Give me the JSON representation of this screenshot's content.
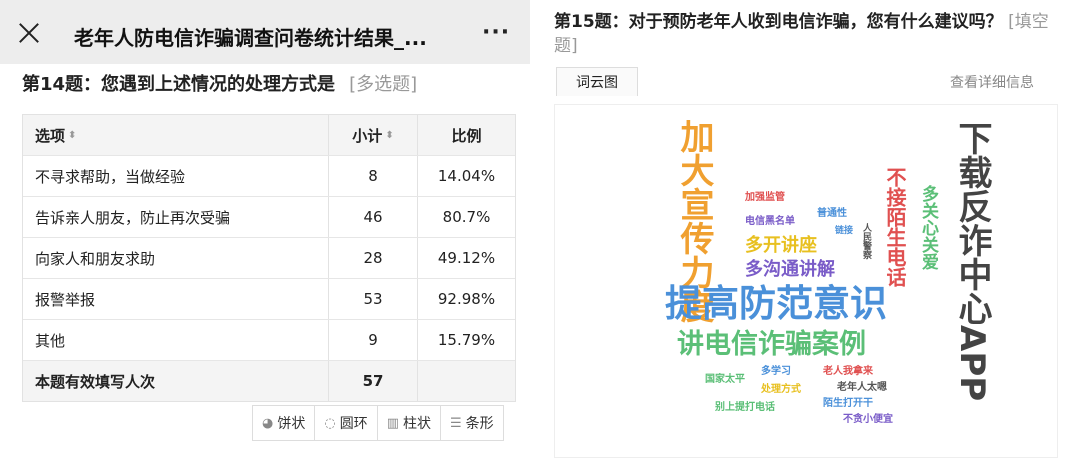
{
  "left": {
    "topbar": {
      "title": "老年人防电信诈骗调查问卷统计结果_...",
      "more": "···"
    },
    "question": {
      "title": "第14题：您遇到上述情况的处理方式是",
      "type": "[多选题]"
    },
    "table": {
      "headers": [
        "选项",
        "小计",
        "比例"
      ],
      "rows": [
        {
          "option": "不寻求帮助，当做经验",
          "count": "8",
          "pct": "14.04%"
        },
        {
          "option": "告诉亲人朋友，防止再次受骗",
          "count": "46",
          "pct": "80.7%"
        },
        {
          "option": "向家人和朋友求助",
          "count": "28",
          "pct": "49.12%"
        },
        {
          "option": "报警举报",
          "count": "53",
          "pct": "92.98%"
        },
        {
          "option": "其他",
          "count": "9",
          "pct": "15.79%"
        }
      ],
      "total_label": "本题有效填写人次",
      "total_value": "57"
    },
    "chart_tabs": [
      {
        "icon": "pie-icon",
        "label": "饼状"
      },
      {
        "icon": "ring-icon",
        "label": "圆环"
      },
      {
        "icon": "column-icon",
        "label": "柱状"
      },
      {
        "icon": "bar-icon",
        "label": "条形"
      }
    ]
  },
  "right": {
    "question": {
      "title": "第15题：对于预防老年人收到电信诈骗，您有什么建议吗？",
      "type": "[填空题]"
    },
    "wordcloud_tab": "词云图",
    "detail_link": "查看详细信息",
    "words": {
      "w1": "提高防范意识",
      "w2": "讲电信诈骗案例",
      "w3": "下载反诈中心APP",
      "w4": "加大宣传力度",
      "w5": "不接陌生电话",
      "w6": "多关心关爱",
      "w7": "多开讲座",
      "w8": "多沟通讲解",
      "w9": "加强监管",
      "w10": "电信黑名单",
      "w11": "普通性",
      "w12": "链接",
      "w13": "人民警察",
      "w14": "多学习",
      "w15": "老人我拿来",
      "w16": "老年人太嗯",
      "w17": "国家太平",
      "w18": "处理方式",
      "w19": "陌生打开干",
      "w20": "不贪小便宜",
      "w21": "别上提打电话"
    },
    "colors": {
      "orange": "#f0a030",
      "gray": "#555555",
      "blue": "#4a90d9",
      "green": "#5bbf77",
      "red": "#e05050",
      "purple": "#7a5cc8",
      "yellow": "#e8c020"
    }
  }
}
